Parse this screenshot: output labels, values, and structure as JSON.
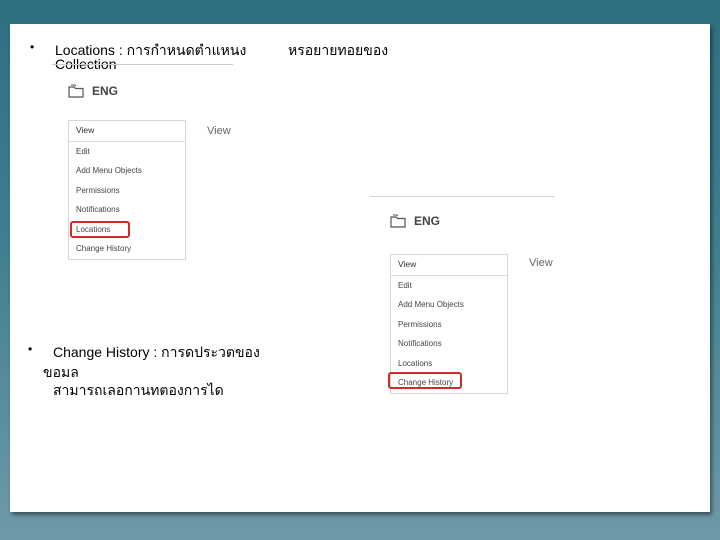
{
  "bullets": {
    "symbol": "•",
    "locations": {
      "line1": "Locations : การกำหนดตำแหนง",
      "line2": "Collection",
      "line3": "หรอยายทอยของ"
    },
    "change_history": {
      "line1": "Change History : การดประวตของ",
      "line2": "ขอมล",
      "line3": "สามารถเลอกานทตองการได"
    }
  },
  "screenshot_top": {
    "collection": "ENG",
    "view_label": "View",
    "menu": [
      "View",
      "Edit",
      "Add Menu Objects",
      "Permissions",
      "Notifications",
      "Locations",
      "Change History"
    ],
    "highlighted_item": "Locations"
  },
  "screenshot_bottom": {
    "collection": "ENG",
    "view_label": "View",
    "menu": [
      "View",
      "Edit",
      "Add Menu Objects",
      "Permissions",
      "Notifications",
      "Locations",
      "Change History"
    ],
    "highlighted_item": "Change History"
  },
  "colors": {
    "highlight": "#d22b2b",
    "background": "#2f6f80"
  }
}
